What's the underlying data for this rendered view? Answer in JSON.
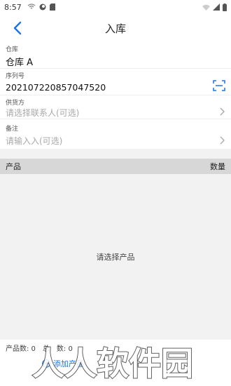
{
  "statusbar": {
    "time": "8:57"
  },
  "header": {
    "title": "入库"
  },
  "form": {
    "warehouse": {
      "label": "仓库",
      "value": "仓库 A"
    },
    "serial": {
      "label": "序列号",
      "value": "202107220857047520"
    },
    "supplier": {
      "label": "供货方",
      "placeholder": "请选择联系人(可选)"
    },
    "note": {
      "label": "备注",
      "placeholder": "请输入入(可选)"
    }
  },
  "list": {
    "col_product": "产品",
    "col_qty": "数量",
    "empty_text": "请选择产品"
  },
  "footer": {
    "product_count_label": "产品数: 0",
    "total_label": "总",
    "total_count_label": "数: 0",
    "add_button_label": "添加产品"
  },
  "watermark": {
    "text": "人人软件园"
  },
  "colors": {
    "accent": "#1a73e8",
    "list_header_bg": "#d7d7d7",
    "list_bg": "#f2f2f2"
  }
}
